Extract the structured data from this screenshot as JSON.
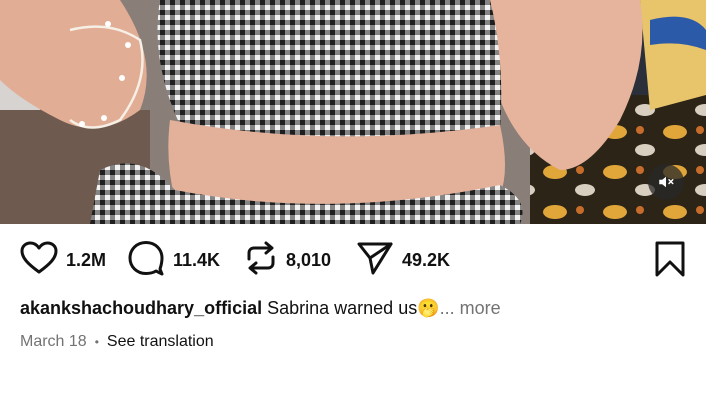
{
  "media": {
    "mute_icon": "volume-muted-icon"
  },
  "actions": {
    "likes": "1.2M",
    "comments": "11.4K",
    "reposts": "8,010",
    "shares": "49.2K"
  },
  "caption": {
    "username": "akankshachoudhary_official",
    "text": "Sabrina warned us",
    "emoji": "🫢",
    "more": "... more"
  },
  "meta": {
    "date": "March 18",
    "separator": "•",
    "translate": "See translation"
  }
}
